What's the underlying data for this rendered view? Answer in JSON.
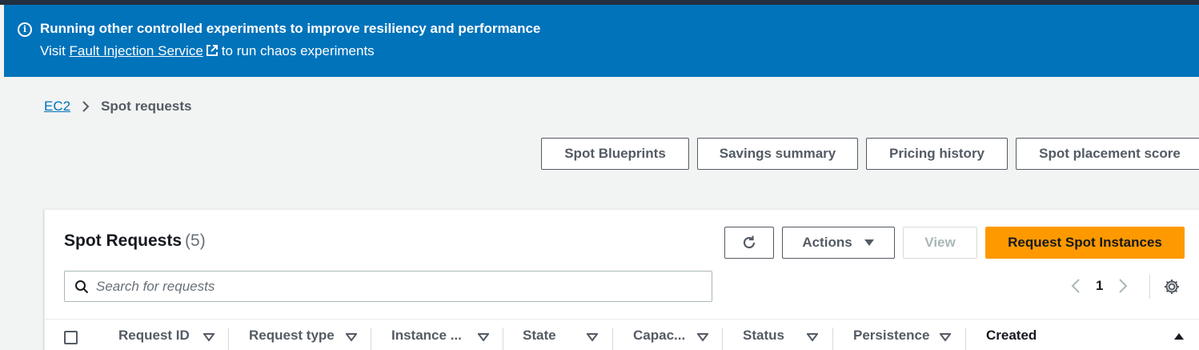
{
  "banner": {
    "title": "Running other controlled experiments to improve resiliency and performance",
    "sub_prefix": "Visit",
    "link_text": "Fault Injection Service",
    "sub_suffix": "to run chaos experiments"
  },
  "breadcrumb": {
    "root": "EC2",
    "current": "Spot requests"
  },
  "top_buttons": {
    "blueprints": "Spot Blueprints",
    "savings": "Savings summary",
    "pricing": "Pricing history",
    "placement": "Spot placement score"
  },
  "panel": {
    "title": "Spot Requests",
    "count": "(5)",
    "actions": "Actions",
    "view": "View",
    "request": "Request Spot Instances",
    "search_placeholder": "Search for requests",
    "page": "1"
  },
  "columns": [
    "Request ID",
    "Request type",
    "Instance ...",
    "State",
    "Capac...",
    "Status",
    "Persistence",
    "Created"
  ],
  "icons": {
    "info": "info-icon",
    "external": "external-link-icon",
    "refresh": "refresh-icon",
    "settings": "gear-icon"
  },
  "colors": {
    "banner": "#0073bb",
    "primary": "#ff9900",
    "link": "#0073bb"
  }
}
